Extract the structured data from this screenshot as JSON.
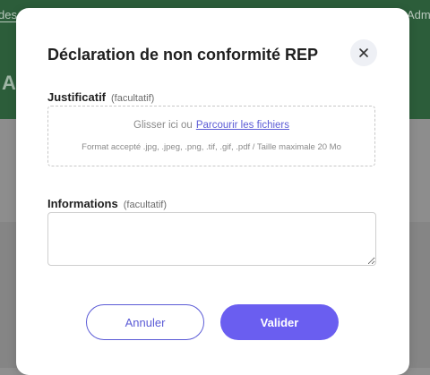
{
  "background": {
    "nav_left": "des",
    "nav_right": "Adm",
    "heading_initial": "A",
    "header_color": "#2c5d3a"
  },
  "modal": {
    "title": "Déclaration de non conformité REP",
    "close_icon": "close-icon",
    "justificatif": {
      "label": "Justificatif",
      "optional": "(facultatif)",
      "drop_text": "Glisser ici ou",
      "browse_link": "Parcourir les fichiers",
      "format_hint": "Format accepté .jpg, .jpeg, .png, .tif, .gif, .pdf / Taille maximale 20 Mo"
    },
    "informations": {
      "label": "Informations",
      "optional": "(facultatif)",
      "value": ""
    },
    "buttons": {
      "cancel_label": "Annuler",
      "submit_label": "Valider"
    },
    "accent_color": "#6a5ef0"
  }
}
